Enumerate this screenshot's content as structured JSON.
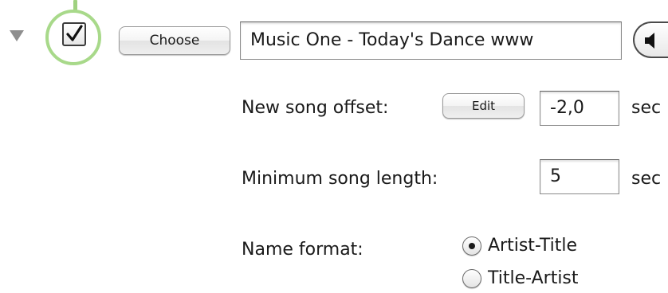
{
  "source": {
    "enabled": true,
    "choose_label": "Choose",
    "track_title": "Music One - Today's Dance www",
    "speaker_icon": "speaker-icon"
  },
  "settings": {
    "new_song_offset": {
      "label": "New song offset:",
      "edit_label": "Edit",
      "value": "-2,0",
      "unit": "sec"
    },
    "minimum_song_length": {
      "label": "Minimum song length:",
      "value": "5",
      "unit": "sec"
    },
    "name_format": {
      "label": "Name format:",
      "options": [
        {
          "label": "Artist-Title",
          "selected": true
        },
        {
          "label": "Title-Artist",
          "selected": false
        }
      ]
    }
  },
  "colors": {
    "focus_ring": "#a8d98a",
    "disclosure": "#8e8e8e"
  }
}
